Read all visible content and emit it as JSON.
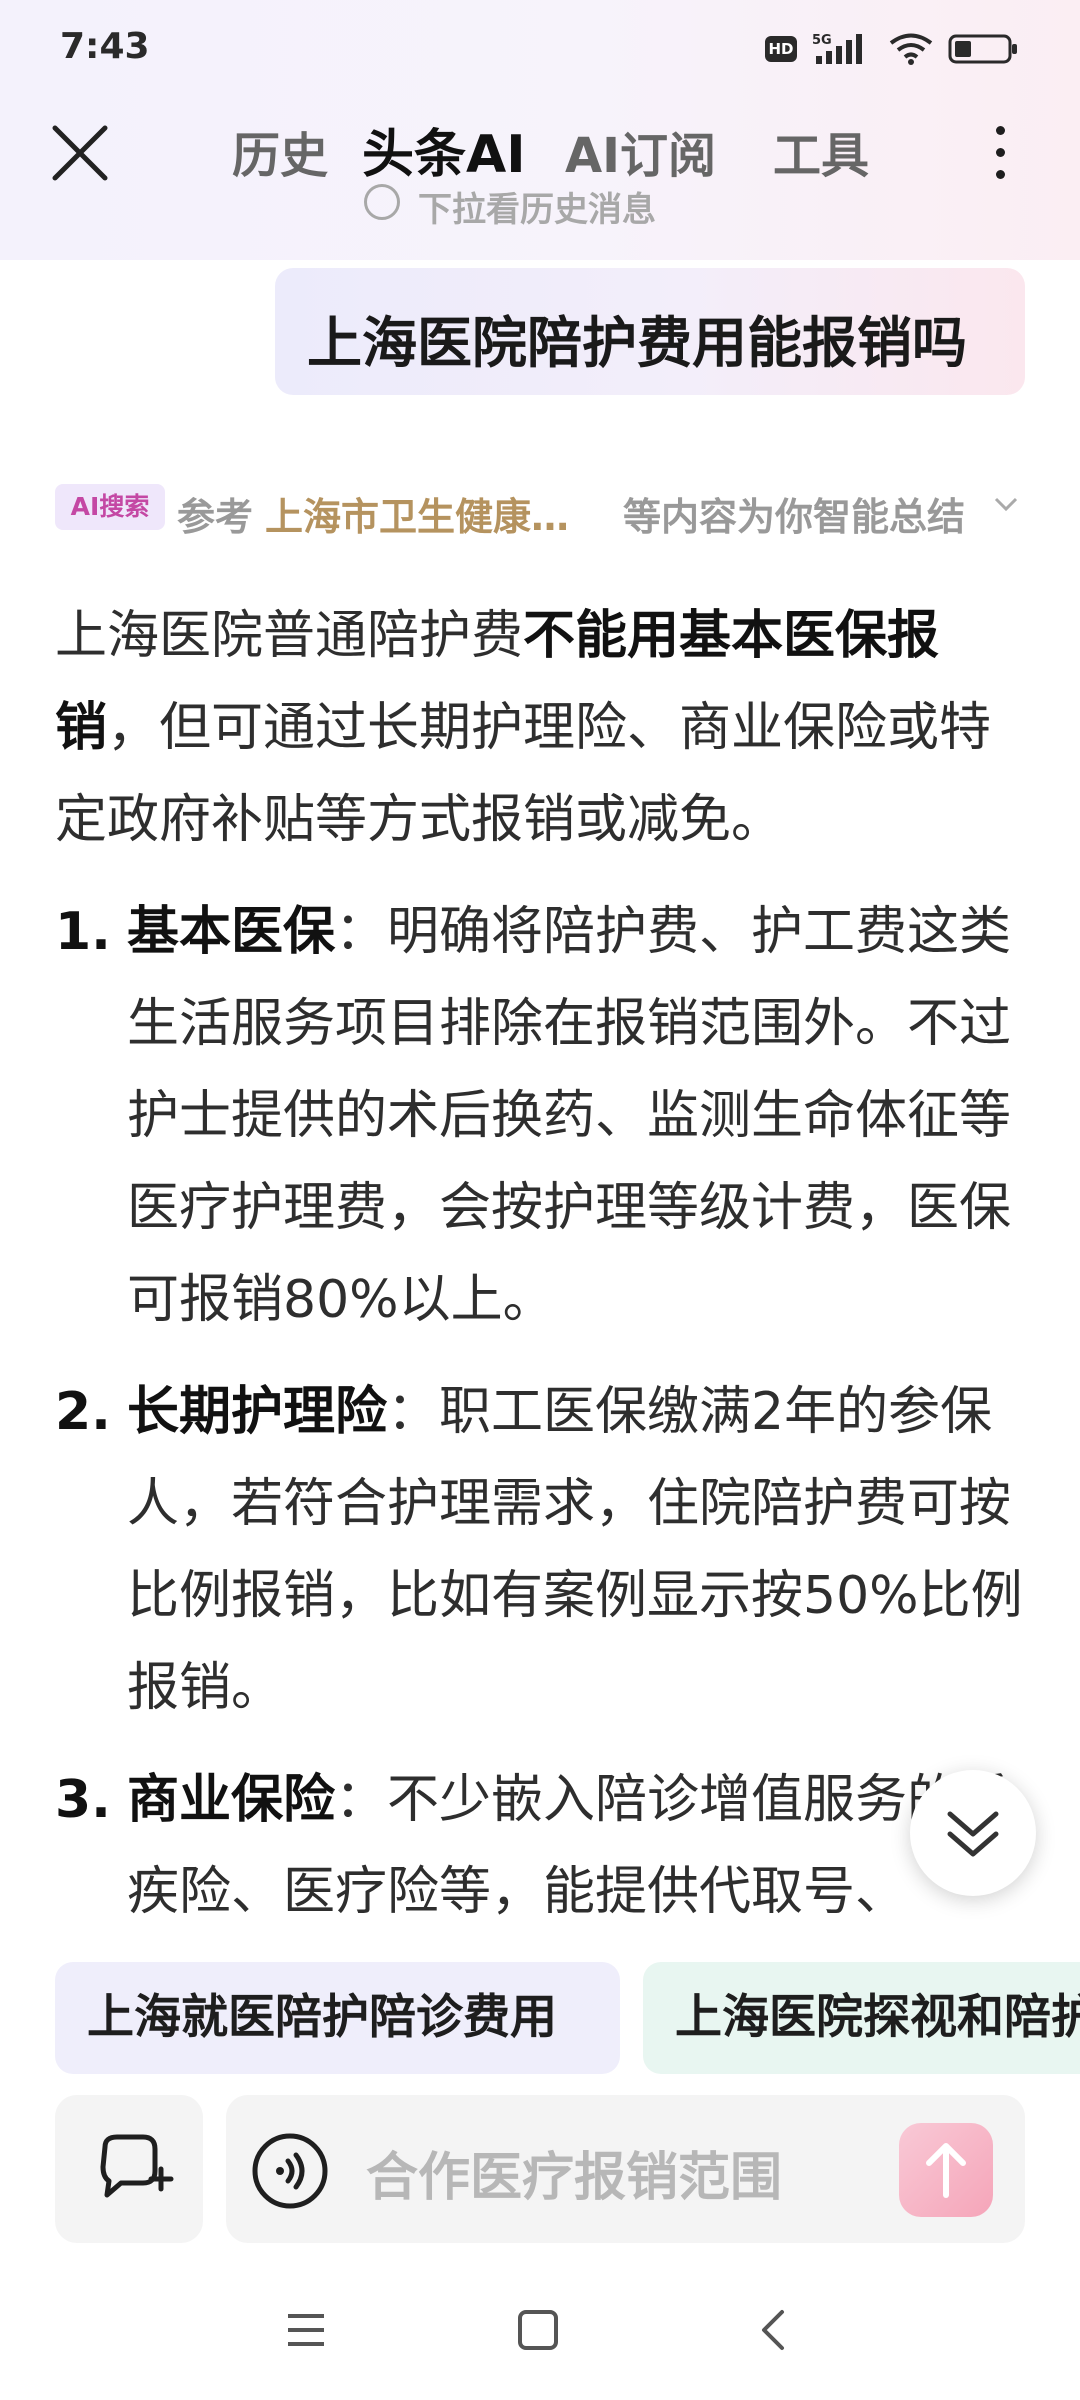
{
  "status_bar": {
    "time": "7:43",
    "hd_badge": "HD",
    "network": "5G",
    "icons": [
      "hd-icon",
      "signal-icon",
      "wifi-icon",
      "battery-icon"
    ]
  },
  "nav": {
    "close_icon": "close-icon",
    "tabs": [
      {
        "label": "历史",
        "active": false
      },
      {
        "label": "头条AI",
        "active": true
      },
      {
        "label": "AI订阅",
        "active": false
      },
      {
        "label": "工具",
        "active": false
      }
    ],
    "more_icon": "more-vertical-icon"
  },
  "history_hint": "下拉看历史消息",
  "user_query": "上海医院陪护费用能报销吗",
  "source": {
    "badge": "AI搜索",
    "ref_label": "参考",
    "ref_source": "上海市卫生健康…",
    "ref_suffix": "等内容为你智能总结"
  },
  "answer": {
    "intro_pre": "上海医院普通陪护费",
    "intro_bold": "不能用基本医保报销",
    "intro_post": "，但可通过长期护理险、商业保险或特定政府补贴等方式报销或减免。",
    "items": [
      {
        "num": "1.",
        "title": "基本医保",
        "text": "：明确将陪护费、护工费这类生活服务项目排除在报销范围外。不过护士提供的术后换药、监测生命体征等医疗护理费，会按护理等级计费，医保可报销80%以上。"
      },
      {
        "num": "2.",
        "title": "长期护理险",
        "text": "：职工医保缴满2年的参保人，若符合护理需求，住院陪护费可按比例报销，比如有案例显示按50%比例报销。"
      },
      {
        "num": "3.",
        "title": "商业保险",
        "text": "：不少嵌入陪诊增值服务的重疾险、医疗险等，能提供代取号、"
      }
    ]
  },
  "suggestions": [
    "上海就医陪护陪诊费用",
    "上海医院探视和陪护"
  ],
  "input": {
    "placeholder": "合作医疗报销范围",
    "new_chat_icon": "new-chat-icon",
    "voice_icon": "voice-icon",
    "send_icon": "send-arrow-icon",
    "scroll_down_icon": "double-chevron-down-icon"
  },
  "system_nav": [
    "menu-icon",
    "home-icon",
    "back-icon"
  ],
  "colors": {
    "accent_pink": "#c448a4",
    "source_gold": "#b5935f",
    "send_button": "#f5a5b9"
  }
}
